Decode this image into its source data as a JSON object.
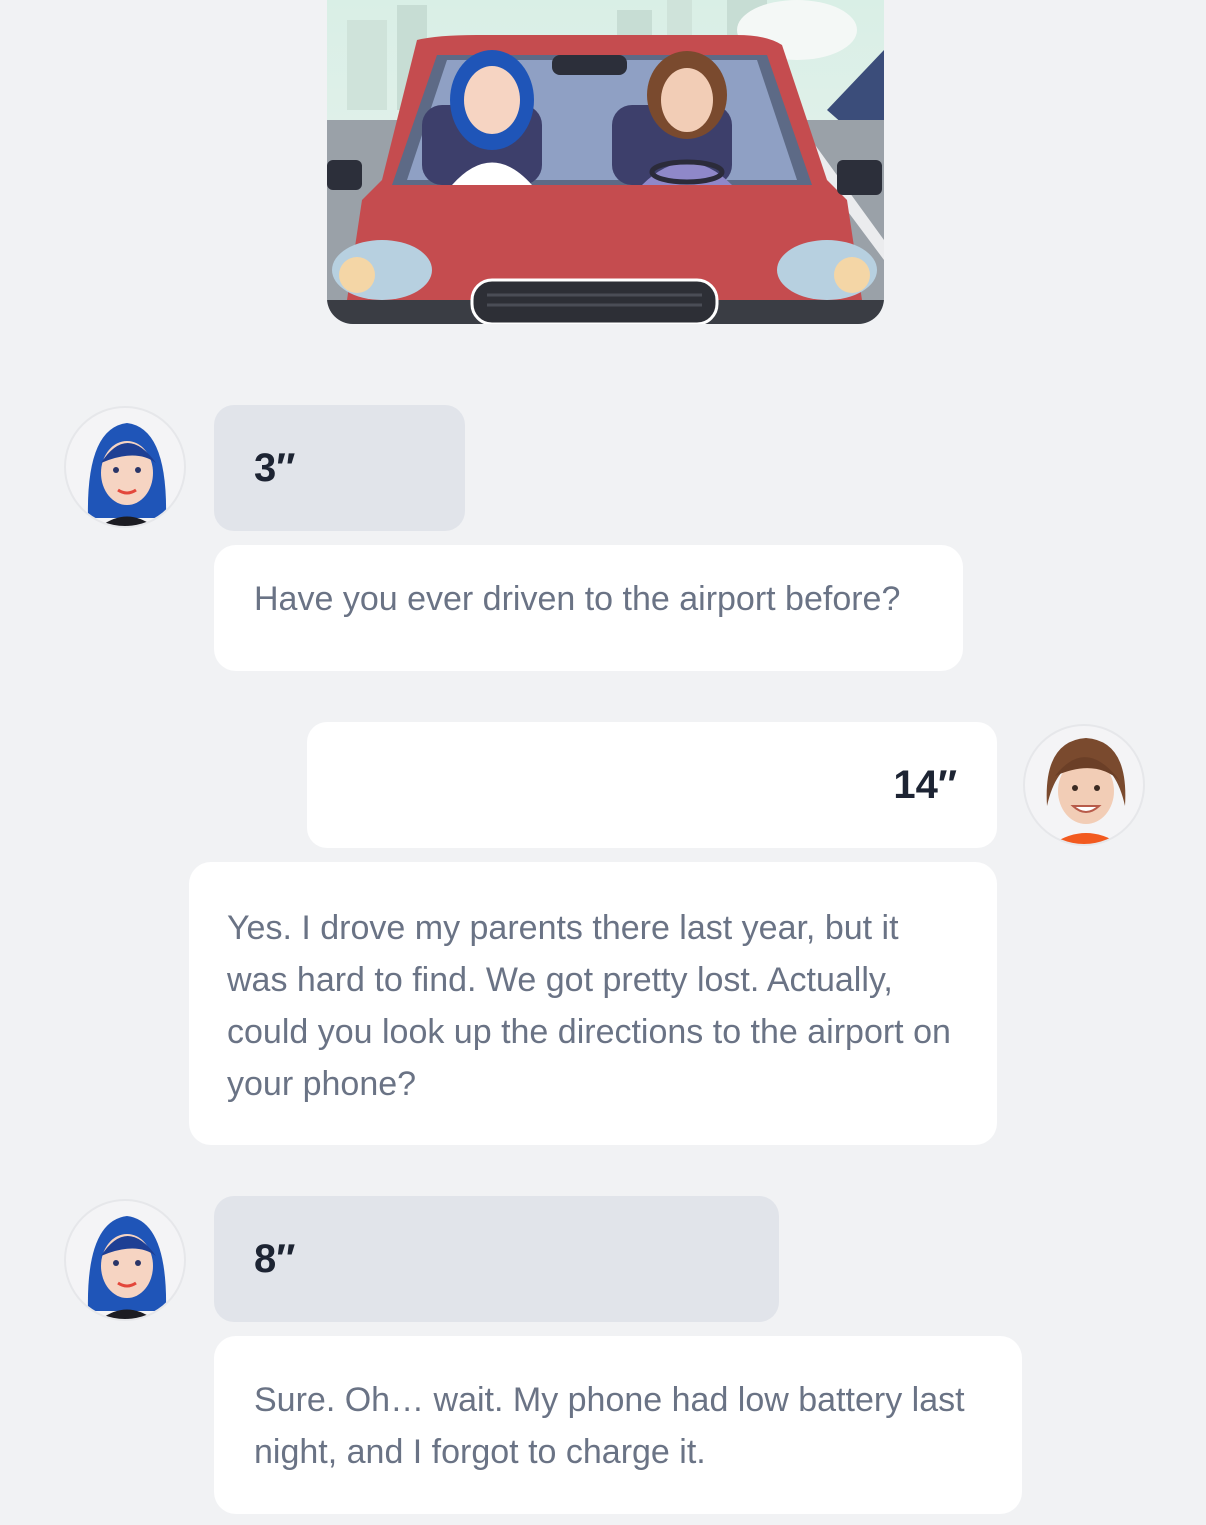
{
  "conversation": {
    "scene_image": "car-scene-illustration",
    "messages": [
      {
        "speaker": "woman-blue-hair",
        "side": "left",
        "duration": "3″",
        "text": "Have you ever driven to the airport before?"
      },
      {
        "speaker": "man-brown-hair",
        "side": "right",
        "duration": "14″",
        "text": "Yes. I drove my parents there last year, but it was hard to find. We got pretty lost. Actually, could you look up the directions to the airport on your phone?"
      },
      {
        "speaker": "woman-blue-hair",
        "side": "left",
        "duration": "8″",
        "text": "Sure. Oh… wait. My phone had low battery last night, and I forgot to charge it."
      }
    ]
  },
  "colors": {
    "background": "#f1f2f4",
    "audio_bubble": "#e1e4ea",
    "text_bubble": "#ffffff",
    "duration_text": "#1d2433",
    "message_text": "#6a7385"
  }
}
